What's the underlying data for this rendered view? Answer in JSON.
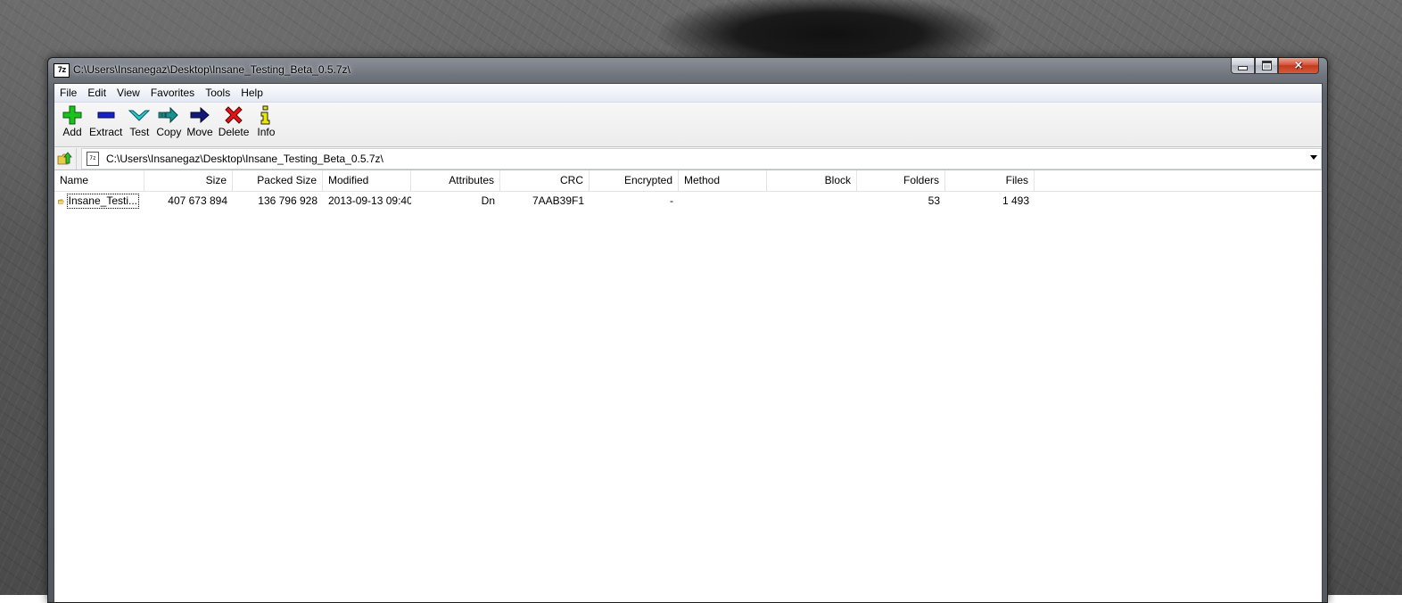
{
  "window": {
    "title": "C:\\Users\\Insanegaz\\Desktop\\Insane_Testing_Beta_0.5.7z\\",
    "icon_text": "7z",
    "controls": {
      "minimize": "minimize-icon",
      "maximize": "maximize-icon",
      "close": "×"
    }
  },
  "menu": {
    "items": [
      "File",
      "Edit",
      "View",
      "Favorites",
      "Tools",
      "Help"
    ]
  },
  "toolbar": {
    "buttons": [
      {
        "label": "Add",
        "icon": "plus-icon",
        "color": "#1fbf1f"
      },
      {
        "label": "Extract",
        "icon": "minus-icon",
        "color": "#1a22c8"
      },
      {
        "label": "Test",
        "icon": "check-icon",
        "color": "#2cc0c8"
      },
      {
        "label": "Copy",
        "icon": "copy-arrow-icon",
        "color": "#1a8a8a"
      },
      {
        "label": "Move",
        "icon": "move-arrow-icon",
        "color": "#101a7a"
      },
      {
        "label": "Delete",
        "icon": "delete-x-icon",
        "color": "#e01010"
      },
      {
        "label": "Info",
        "icon": "info-icon",
        "color": "#e8e800"
      }
    ]
  },
  "address": {
    "path": "C:\\Users\\Insanegaz\\Desktop\\Insane_Testing_Beta_0.5.7z\\",
    "icon_text": "7z"
  },
  "list": {
    "columns": [
      "Name",
      "Size",
      "Packed Size",
      "Modified",
      "Attributes",
      "CRC",
      "Encrypted",
      "Method",
      "Block",
      "Folders",
      "Files"
    ],
    "rows": [
      {
        "name": "Insane_Testi...",
        "size": "407 673 894",
        "packed": "136 796 928",
        "modified": "2013-09-13 09:40",
        "attributes": "Dn",
        "crc": "7AAB39F1",
        "encrypted": "-",
        "method": "",
        "block": "",
        "folders": "53",
        "files": "1 493"
      }
    ]
  }
}
